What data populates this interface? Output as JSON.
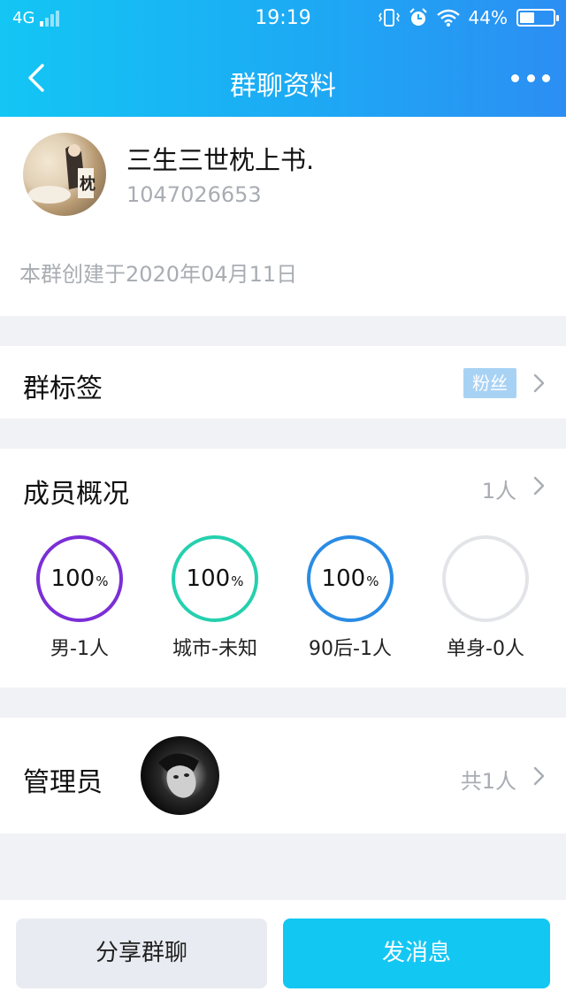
{
  "status_bar": {
    "network": "4G",
    "time": "19:19",
    "battery_percent": "44%",
    "battery_level": 0.44
  },
  "nav": {
    "title": "群聊资料"
  },
  "group": {
    "name": "三生三世枕上书.",
    "id": "1047026653",
    "created": "本群创建于2020年04月11日"
  },
  "tags": {
    "title": "群标签",
    "badge": "粉丝"
  },
  "members": {
    "title": "成员概况",
    "count": "1人",
    "stats": [
      {
        "value": "100",
        "unit": "%",
        "label": "男-1人",
        "color": "#7b2fd6"
      },
      {
        "value": "100",
        "unit": "%",
        "label": "城市-未知",
        "color": "#25d0ae"
      },
      {
        "value": "100",
        "unit": "%",
        "label": "90后-1人",
        "color": "#2a8ce4"
      },
      {
        "value": "",
        "unit": "",
        "label": "单身-0人",
        "color": "#e2e4e8"
      }
    ]
  },
  "admin": {
    "title": "管理员",
    "count": "共1人"
  },
  "actions": {
    "share": "分享群聊",
    "send": "发消息"
  },
  "colors": {
    "header_start": "#13c6f4",
    "header_end": "#2c8ef3",
    "send_button": "#13c7f3",
    "tag_badge": "#a8d2f4"
  }
}
